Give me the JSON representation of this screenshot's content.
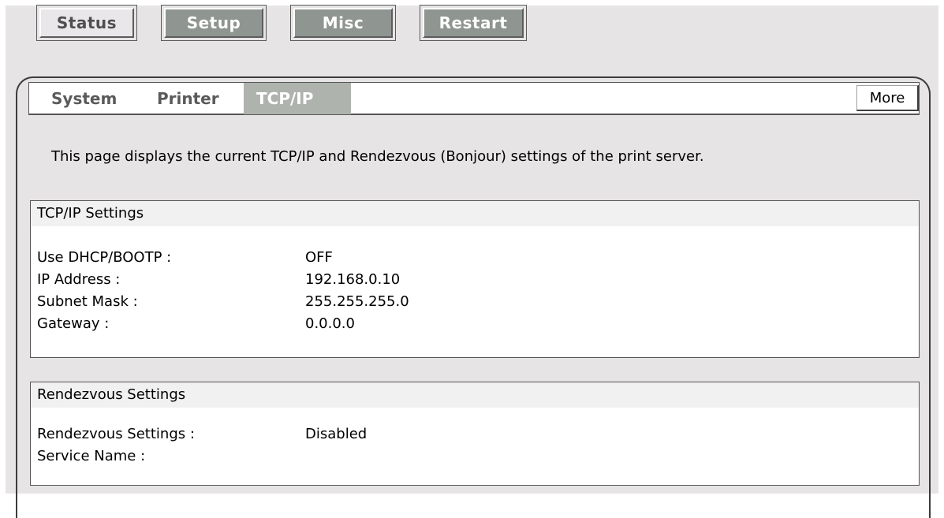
{
  "top_tabs": [
    {
      "label": "Status",
      "state": "active"
    },
    {
      "label": "Setup",
      "state": "inactive"
    },
    {
      "label": "Misc",
      "state": "inactive"
    },
    {
      "label": "Restart",
      "state": "inactive"
    }
  ],
  "sub_tabs": [
    {
      "label": "System"
    },
    {
      "label": "Printer"
    },
    {
      "label": "TCP/IP",
      "selected": true
    }
  ],
  "more_label": "More",
  "intro_text": "This page displays the current TCP/IP and Rendezvous (Bonjour) settings of the print server.",
  "tcpip": {
    "title": "TCP/IP Settings",
    "rows": [
      {
        "label": "Use DHCP/BOOTP :",
        "value": "OFF"
      },
      {
        "label": "IP Address :",
        "value": "192.168.0.10"
      },
      {
        "label": "Subnet Mask :",
        "value": "255.255.255.0"
      },
      {
        "label": "Gateway :",
        "value": "0.0.0.0"
      }
    ]
  },
  "rendezvous": {
    "title": "Rendezvous Settings",
    "rows": [
      {
        "label": "Rendezvous Settings :",
        "value": "Disabled"
      },
      {
        "label": "Service Name :",
        "value": ""
      }
    ]
  },
  "colors": {
    "page_bg": "#e7e4e6",
    "inactive_tab_bg": "#8f9590",
    "selected_subtab_bg": "#aeb3ae"
  }
}
